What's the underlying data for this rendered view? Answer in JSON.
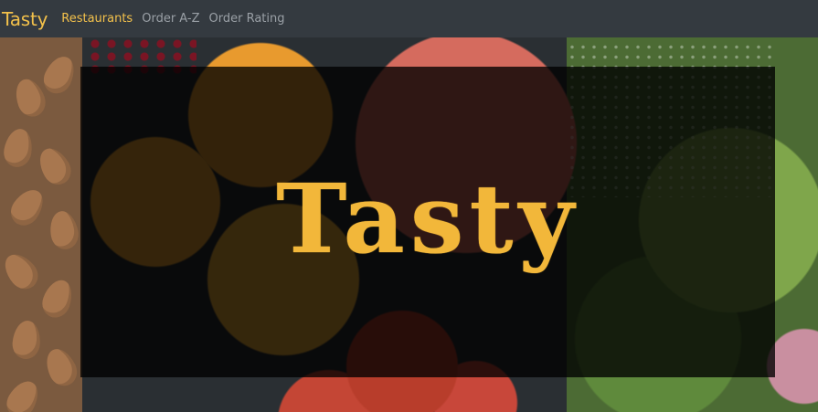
{
  "navbar": {
    "brand": "Tasty",
    "links": [
      {
        "label": "Restaurants",
        "active": true
      },
      {
        "label": "Order A-Z",
        "active": false
      },
      {
        "label": "Order Rating",
        "active": false
      }
    ]
  },
  "hero": {
    "title": "Tasty",
    "image_subject": "fresh-produce-background"
  },
  "colors": {
    "accent": "#f3c14b",
    "navbar_bg": "#343a40",
    "muted_link": "#9aa0a6"
  }
}
